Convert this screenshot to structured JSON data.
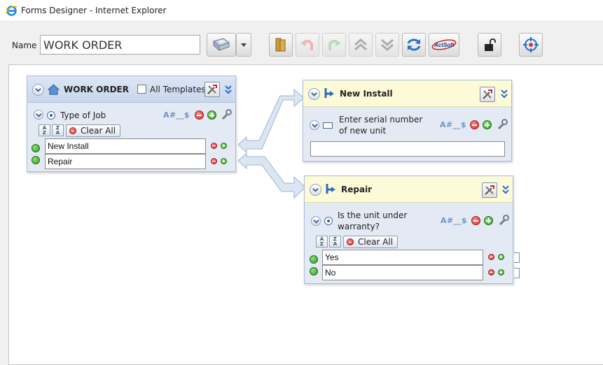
{
  "window": {
    "title": "Forms Designer - Internet Explorer"
  },
  "toolbar": {
    "name_label": "Name",
    "name_value": "WORK ORDER",
    "buttons": [
      {
        "name": "save-button",
        "icon": "floppy-disk-icon"
      },
      {
        "name": "save-dropdown",
        "icon": "caret-down-icon"
      },
      {
        "name": "library-button",
        "icon": "books-icon"
      },
      {
        "name": "undo-button",
        "icon": "undo-icon"
      },
      {
        "name": "redo-button",
        "icon": "redo-icon"
      },
      {
        "name": "move-up-button",
        "icon": "double-chevron-up-icon"
      },
      {
        "name": "move-down-button",
        "icon": "double-chevron-down-icon"
      },
      {
        "name": "refresh-button",
        "icon": "refresh-icon"
      },
      {
        "name": "actsoft-button",
        "icon": "actsoft-logo-icon",
        "label": "ActSoft"
      },
      {
        "name": "lock-button",
        "icon": "padlock-icon"
      },
      {
        "name": "target-button",
        "icon": "target-icon"
      }
    ]
  },
  "form": {
    "title": "WORK ORDER",
    "all_templates_label": "All Templates",
    "question": {
      "label": "Type of Job",
      "format": "A#__$",
      "clear_all": "Clear All",
      "options": [
        "New Install",
        "Repair"
      ]
    }
  },
  "branch_new_install": {
    "title": "New Install",
    "question": {
      "line1": "Enter serial number",
      "line2": "of new unit",
      "format": "A#__$",
      "value": ""
    }
  },
  "branch_repair": {
    "title": "Repair",
    "question": {
      "line1": "Is the unit under",
      "line2": "warranty?",
      "format": "A#__$",
      "clear_all": "Clear All",
      "options": [
        "Yes",
        "No"
      ]
    }
  },
  "colors": {
    "panel_bg": "#e4eaf3",
    "panel_header": "#c9d7ec",
    "branch_header": "#fdfbd7",
    "accent": "#2b6cc4",
    "connector": "#dbe6f2"
  }
}
